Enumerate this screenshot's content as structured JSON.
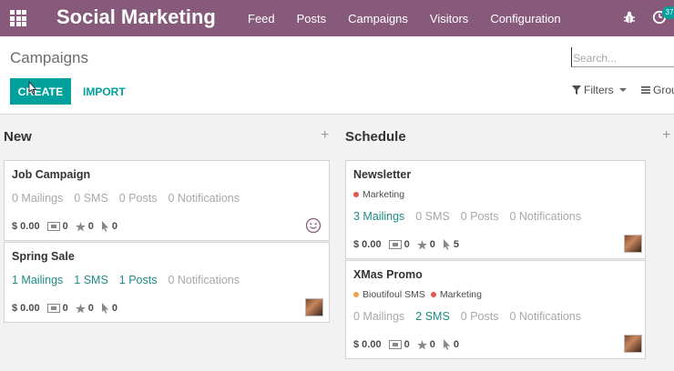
{
  "app": {
    "title": "Social Marketing",
    "activity_count": "37"
  },
  "nav": {
    "items": [
      {
        "label": "Feed"
      },
      {
        "label": "Posts"
      },
      {
        "label": "Campaigns"
      },
      {
        "label": "Visitors"
      },
      {
        "label": "Configuration"
      }
    ]
  },
  "control": {
    "breadcrumb": "Campaigns",
    "search_placeholder": "Search...",
    "create_label": "CREATE",
    "import_label": "IMPORT",
    "filters_label": "Filters",
    "groupby_label": "Grou"
  },
  "columns": {
    "new": {
      "title": "New",
      "add_label": "+",
      "cards": [
        {
          "title": "Job Campaign",
          "mailings": "0 Mailings",
          "sms": "0 SMS",
          "posts": "0 Posts",
          "notifications": "0 Notifications",
          "amount": "$ 0.00",
          "opened": "0",
          "stars": "0",
          "clicks": "0",
          "avatar": "smile-icon"
        },
        {
          "title": "Spring Sale",
          "mailings": "1 Mailings",
          "sms": "1 SMS",
          "posts": "1 Posts",
          "notifications": "0 Notifications",
          "amount": "$ 0.00",
          "opened": "0",
          "stars": "0",
          "clicks": "0",
          "avatar": "user-avatar"
        }
      ]
    },
    "schedule": {
      "title": "Schedule",
      "add_label": "+",
      "cards": [
        {
          "title": "Newsletter",
          "tags": [
            {
              "label": "Marketing",
              "color": "#e0584b"
            }
          ],
          "mailings": "3 Mailings",
          "sms": "0 SMS",
          "posts": "0 Posts",
          "notifications": "0 Notifications",
          "amount": "$ 0.00",
          "opened": "0",
          "stars": "0",
          "clicks": "5",
          "avatar": "user-avatar"
        },
        {
          "title": "XMas Promo",
          "tags": [
            {
              "label": "Bioutifoul SMS",
              "color": "#f0a050"
            },
            {
              "label": "Marketing",
              "color": "#e0584b"
            }
          ],
          "mailings": "0 Mailings",
          "sms": "2 SMS",
          "posts": "0 Posts",
          "notifications": "0 Notifications",
          "amount": "$ 0.00",
          "opened": "0",
          "stars": "0",
          "clicks": "0",
          "avatar": "user-avatar"
        }
      ]
    }
  },
  "colors": {
    "brand": "#875a7b",
    "primary": "#00a09d",
    "link": "#1f8a86",
    "muted": "#a8a8a8"
  }
}
